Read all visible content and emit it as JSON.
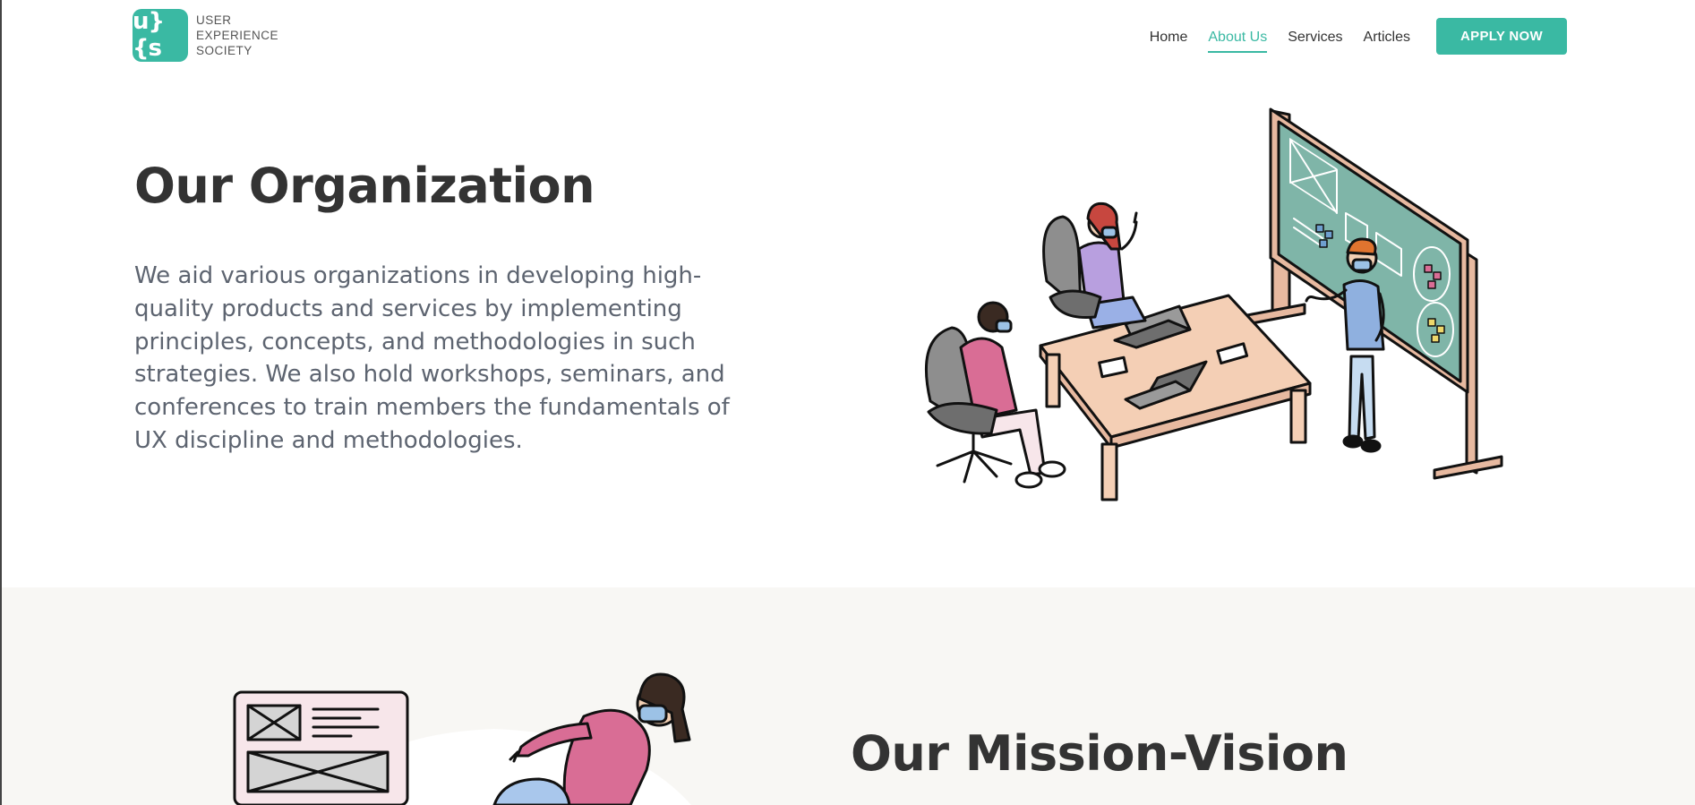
{
  "logo": {
    "mark": "u}{s",
    "lines": [
      "USER",
      "EXPERIENCE",
      "SOCIETY"
    ]
  },
  "nav": {
    "items": [
      {
        "label": "Home",
        "active": false
      },
      {
        "label": "About Us",
        "active": true
      },
      {
        "label": "Services",
        "active": false
      },
      {
        "label": "Articles",
        "active": false
      }
    ],
    "cta": "APPLY NOW"
  },
  "hero": {
    "title": "Our Organization",
    "paragraph": "We aid various organizations in developing high-quality products and services by implementing principles, concepts, and methodologies in such strategies. We also hold workshops, seminars, and conferences to train members the fundamentals of UX discipline and methodologies."
  },
  "mission": {
    "title": "Our Mission-Vision"
  },
  "colors": {
    "accent": "#3ab9a3",
    "text_dark": "#333333",
    "text_body": "#5d6470",
    "section_bg": "#f8f7f4"
  }
}
